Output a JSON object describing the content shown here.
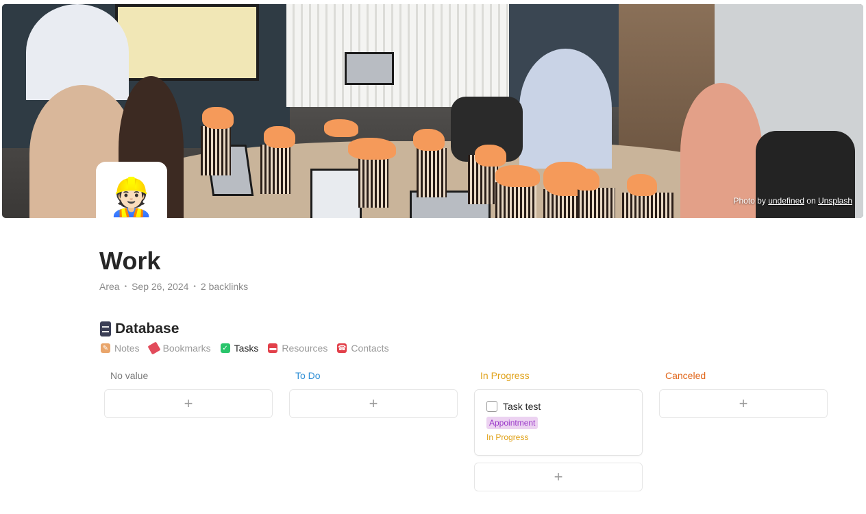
{
  "cover": {
    "credit_prefix": "Photo by",
    "credit_author": "undefined",
    "credit_on": "on",
    "credit_source": "Unsplash"
  },
  "page": {
    "icon": "👷🏻",
    "title": "Work",
    "meta": [
      "Area",
      "Sep 26, 2024",
      "2 backlinks"
    ]
  },
  "database": {
    "title": "Database",
    "views": [
      {
        "label": "Notes",
        "icon": "notes-icon",
        "color": "#e9a56b"
      },
      {
        "label": "Bookmarks",
        "icon": "bookmark-icon",
        "color": "#e24b5b"
      },
      {
        "label": "Tasks",
        "icon": "check-icon",
        "color": "#29c56b"
      },
      {
        "label": "Resources",
        "icon": "toolbox-icon",
        "color": "#e2404a"
      },
      {
        "label": "Contacts",
        "icon": "telephone-icon",
        "color": "#e2404a"
      }
    ],
    "active_view": "Tasks"
  },
  "board": {
    "columns": [
      {
        "label": "No value",
        "color": "#7a7a7a",
        "cards": []
      },
      {
        "label": "To Do",
        "color": "#2f8fd6",
        "cards": []
      },
      {
        "label": "In Progress",
        "color": "#e0a21a",
        "cards": [
          {
            "title": "Task test",
            "tag": "Appointment",
            "status": "In Progress"
          }
        ]
      },
      {
        "label": "Canceled",
        "color": "#e0661a",
        "cards": []
      }
    ],
    "add_symbol": "+"
  }
}
